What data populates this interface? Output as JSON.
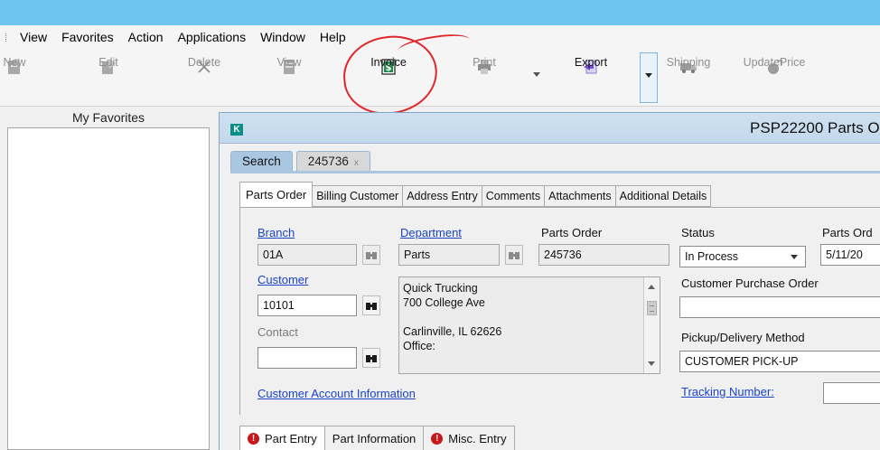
{
  "menu": {
    "items": [
      "View",
      "Favorites",
      "Action",
      "Applications",
      "Window",
      "Help"
    ]
  },
  "toolbar": {
    "new_label": "New",
    "edit_label": "Edit",
    "delete_label": "Delete",
    "view_label": "View",
    "invoice_label": "Invoice",
    "print_label": "Print",
    "export_label": "Export",
    "shipping_label": "Shipping",
    "updateprice_label": "UpdatePrice"
  },
  "favorites": {
    "header": "My Favorites"
  },
  "child_window": {
    "app_icon_text": "K",
    "title": "PSP22200 Parts O",
    "doc_tabs": {
      "search": "Search",
      "order": "245736",
      "close_glyph": "x"
    },
    "form_tabs": [
      "Parts Order",
      "Billing Customer",
      "Address Entry",
      "Comments",
      "Attachments",
      "Additional Details"
    ],
    "form": {
      "branch_link": "Branch",
      "branch_value": "01A",
      "department_link": "Department",
      "department_value": "Parts",
      "parts_order_label": "Parts Order",
      "parts_order_value": "245736",
      "status_label": "Status",
      "status_value": "In Process",
      "parts_order_date_label": "Parts Ord",
      "parts_order_date_value": "5/11/20",
      "customer_link": "Customer",
      "customer_value": "10101",
      "contact_label": "Contact",
      "contact_value": "",
      "address_lines": [
        "Quick Trucking",
        "700 College Ave",
        "",
        "Carlinville, IL 62626",
        "Office:"
      ],
      "cpo_label": "Customer Purchase Order",
      "cpo_value": "",
      "pickup_label": "Pickup/Delivery Method",
      "pickup_value": "CUSTOMER PICK-UP",
      "account_info_link": "Customer Account Information",
      "tracking_link": "Tracking Number:",
      "tracking_value": ""
    },
    "sub_tabs": {
      "part_entry": "Part Entry",
      "part_information": "Part Information",
      "misc_entry": "Misc. Entry",
      "error_glyph": "!"
    }
  },
  "colors": {
    "titlebar": "#6ec6ef",
    "child_titlebar": "#c3d8ec",
    "link": "#1a43c8",
    "annotation": "#e0262a",
    "error": "#c8161d"
  }
}
